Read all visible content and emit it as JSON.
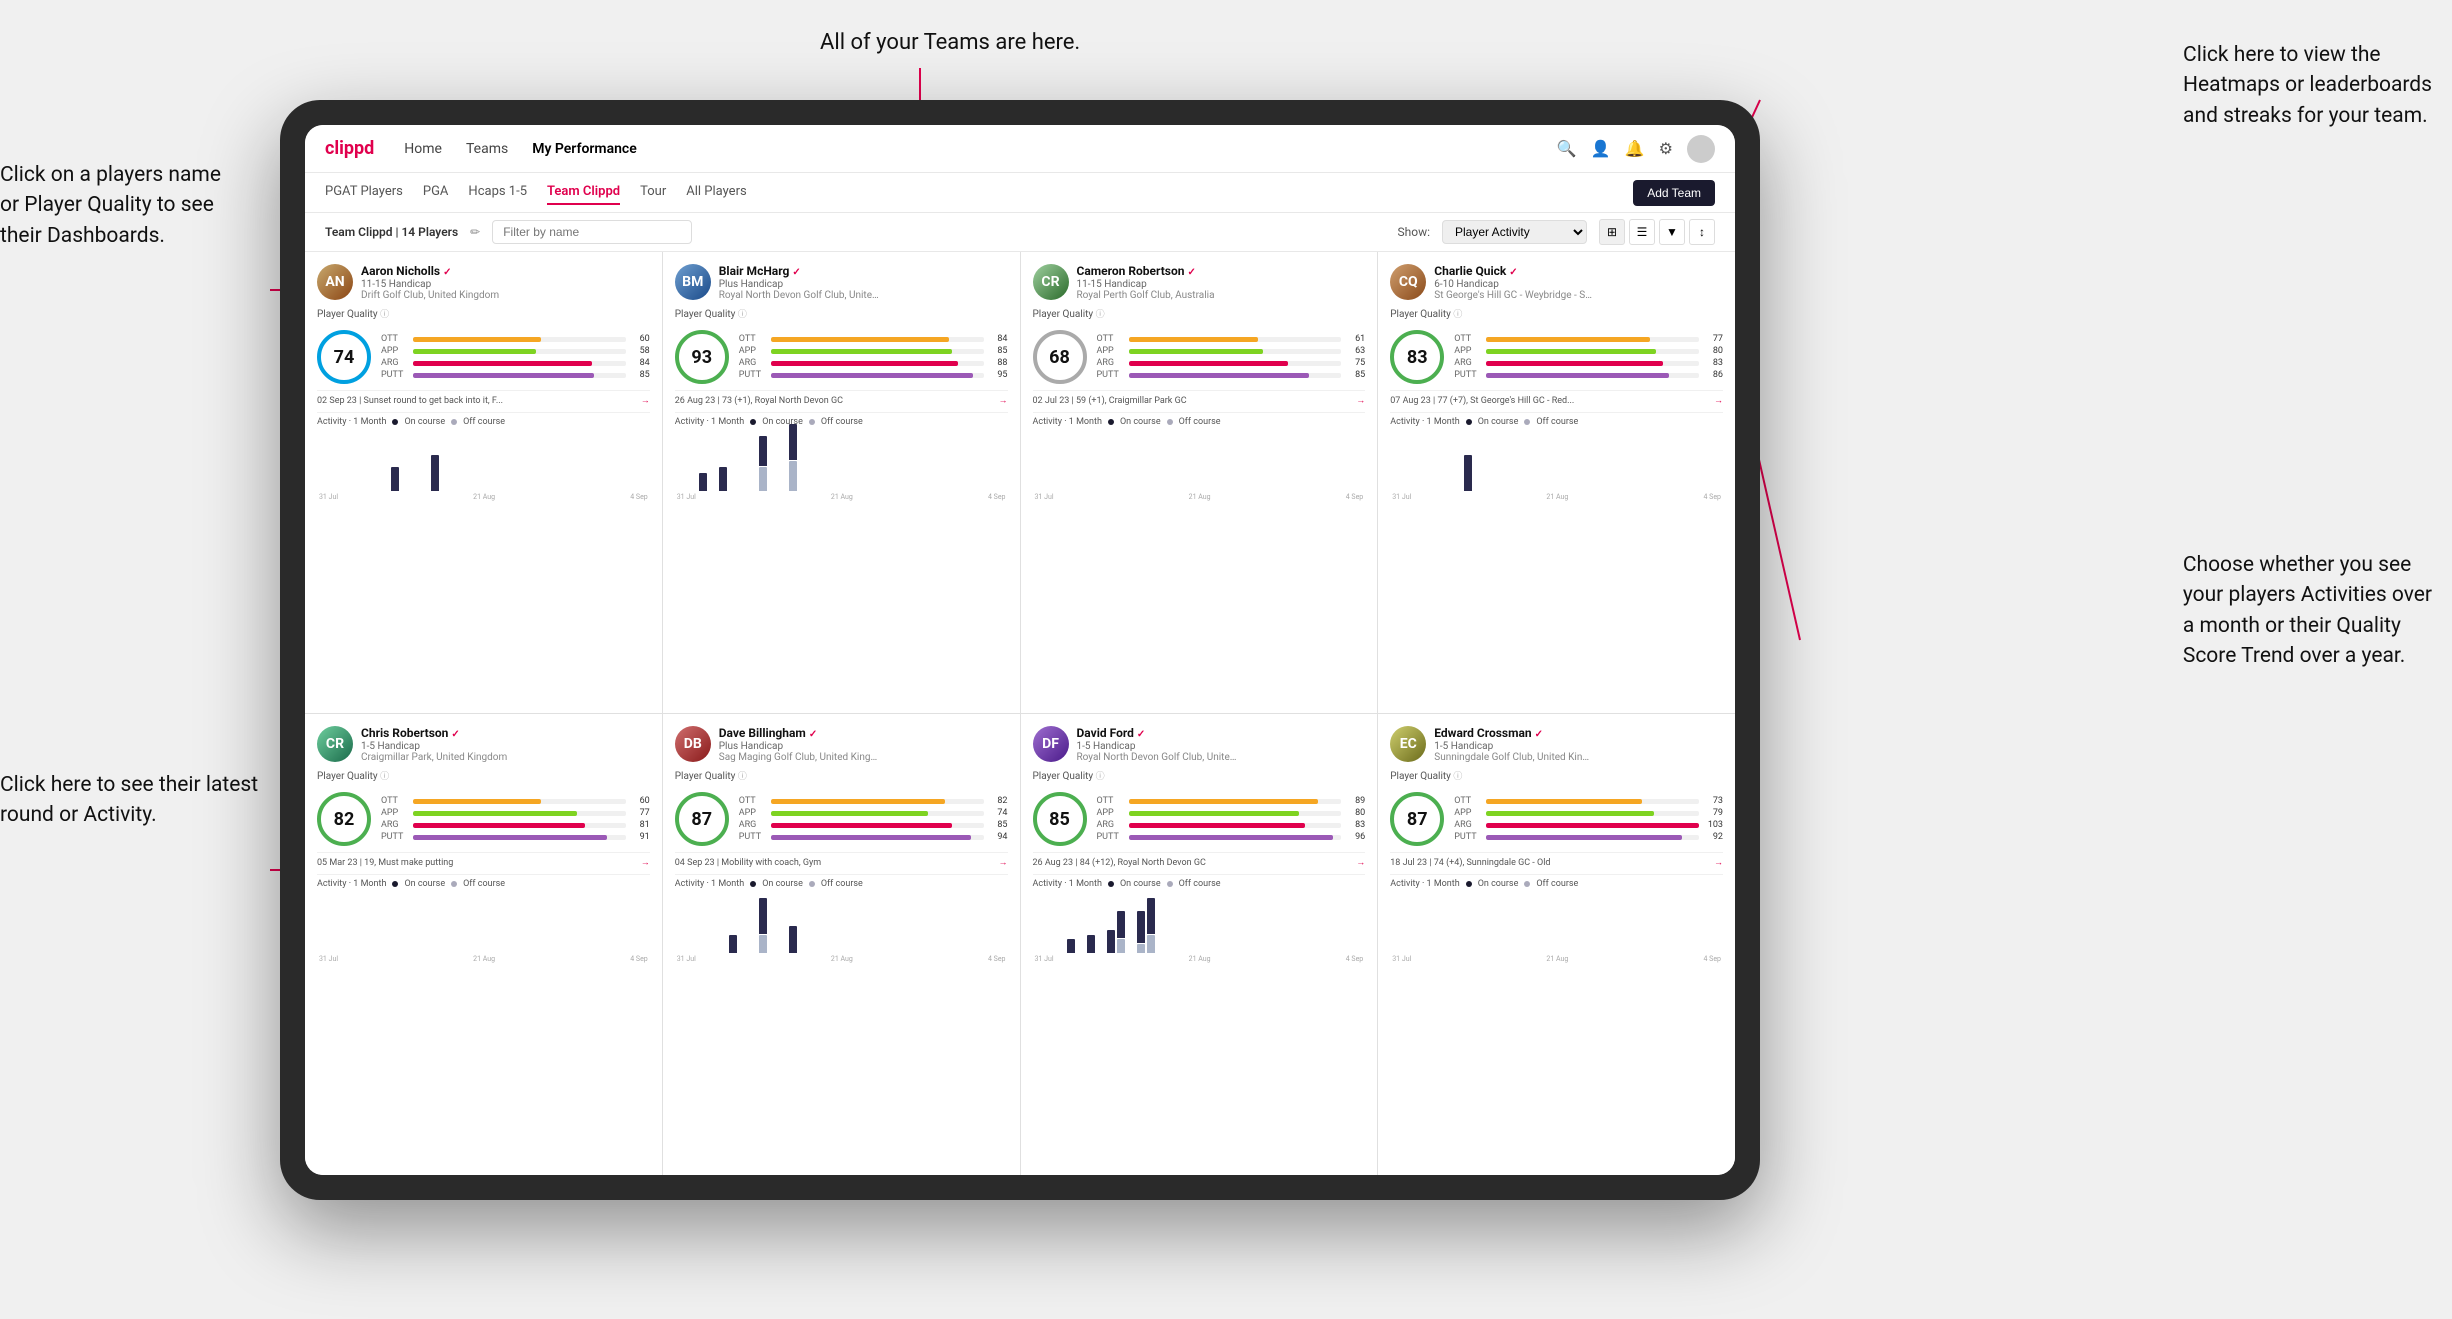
{
  "annotations": {
    "top_center": "All of your Teams are here.",
    "top_right": "Click here to view the\nHeatmaps or leaderboards\nand streaks for your team.",
    "left_top_title": "Click on a players name\nor Player Quality to see\ntheir Dashboards.",
    "left_bottom_title": "Click here to see their latest\nround or Activity.",
    "mid_right": "Choose whether you see\nyour players Activities over\na month or their Quality\nScore Trend over a year."
  },
  "navbar": {
    "logo": "clippd",
    "links": [
      "Home",
      "Teams",
      "My Performance"
    ],
    "active_link": "Teams"
  },
  "subnav": {
    "items": [
      "PGAT Players",
      "PGA",
      "Hcaps 1-5",
      "Team Clippd",
      "Tour",
      "All Players"
    ],
    "active": "Team Clippd",
    "add_team_label": "Add Team"
  },
  "filterbar": {
    "team_label": "Team Clippd | 14 Players",
    "search_placeholder": "Filter by name",
    "show_label": "Show:",
    "show_option": "Player Activity",
    "grid_icon": "⊞",
    "list_icon": "☰",
    "filter_icon": "▼",
    "sort_icon": "↕"
  },
  "players": [
    {
      "name": "Aaron Nicholls",
      "handicap": "11-15 Handicap",
      "club": "Drift Golf Club, United Kingdom",
      "quality": 74,
      "quality_color": "blue",
      "stats": {
        "ott": 60,
        "app": 58,
        "arg": 84,
        "putt": 85
      },
      "last_round": "02 Sep 23 | Sunset round to get back into it, F...",
      "avatar_class": "avatar-aaron",
      "avatar_initials": "AN",
      "activity_bars": [
        0,
        0,
        0,
        0,
        0,
        0,
        0,
        2,
        0,
        0,
        0,
        3,
        0,
        0
      ],
      "activity_bars2": [
        0,
        0,
        0,
        0,
        0,
        0,
        0,
        0,
        0,
        0,
        0,
        0,
        0,
        0
      ]
    },
    {
      "name": "Blair McHarg",
      "handicap": "Plus Handicap",
      "club": "Royal North Devon Golf Club, United Kin...",
      "quality": 93,
      "quality_color": "green",
      "stats": {
        "ott": 84,
        "app": 85,
        "arg": 88,
        "putt": 95
      },
      "last_round": "26 Aug 23 | 73 (+1), Royal North Devon GC",
      "avatar_class": "avatar-blair",
      "avatar_initials": "BM",
      "activity_bars": [
        0,
        0,
        3,
        0,
        4,
        0,
        0,
        0,
        5,
        0,
        0,
        6,
        0,
        0
      ],
      "activity_bars2": [
        0,
        0,
        0,
        0,
        0,
        0,
        0,
        0,
        4,
        0,
        0,
        5,
        0,
        0
      ]
    },
    {
      "name": "Cameron Robertson",
      "handicap": "11-15 Handicap",
      "club": "Royal Perth Golf Club, Australia",
      "quality": 68,
      "quality_color": "blue",
      "stats": {
        "ott": 61,
        "app": 63,
        "arg": 75,
        "putt": 85
      },
      "last_round": "02 Jul 23 | 59 (+1), Craigmillar Park GC",
      "avatar_class": "avatar-cameron",
      "avatar_initials": "CR",
      "activity_bars": [
        0,
        0,
        0,
        0,
        0,
        0,
        0,
        0,
        0,
        0,
        0,
        0,
        0,
        0
      ],
      "activity_bars2": [
        0,
        0,
        0,
        0,
        0,
        0,
        0,
        0,
        0,
        0,
        0,
        0,
        0,
        0
      ]
    },
    {
      "name": "Charlie Quick",
      "handicap": "6-10 Handicap",
      "club": "St George's Hill GC - Weybridge - Surrey...",
      "quality": 83,
      "quality_color": "green",
      "stats": {
        "ott": 77,
        "app": 80,
        "arg": 83,
        "putt": 86
      },
      "last_round": "07 Aug 23 | 77 (+7), St George's Hill GC - Red...",
      "avatar_class": "avatar-charlie",
      "avatar_initials": "CQ",
      "activity_bars": [
        0,
        0,
        0,
        0,
        0,
        0,
        0,
        3,
        0,
        0,
        0,
        0,
        0,
        0
      ],
      "activity_bars2": [
        0,
        0,
        0,
        0,
        0,
        0,
        0,
        0,
        0,
        0,
        0,
        0,
        0,
        0
      ]
    },
    {
      "name": "Chris Robertson",
      "handicap": "1-5 Handicap",
      "club": "Craigmillar Park, United Kingdom",
      "quality": 82,
      "quality_color": "blue",
      "stats": {
        "ott": 60,
        "app": 77,
        "arg": 81,
        "putt": 91
      },
      "last_round": "05 Mar 23 | 19, Must make putting",
      "avatar_class": "avatar-chris",
      "avatar_initials": "CR",
      "activity_bars": [
        0,
        0,
        0,
        0,
        0,
        0,
        0,
        0,
        0,
        0,
        0,
        0,
        0,
        0
      ],
      "activity_bars2": [
        0,
        0,
        0,
        0,
        0,
        0,
        0,
        0,
        0,
        0,
        0,
        0,
        0,
        0
      ]
    },
    {
      "name": "Dave Billingham",
      "handicap": "Plus Handicap",
      "club": "Sag Maging Golf Club, United Kingdom",
      "quality": 87,
      "quality_color": "green",
      "stats": {
        "ott": 82,
        "app": 74,
        "arg": 85,
        "putt": 94
      },
      "last_round": "04 Sep 23 | Mobility with coach, Gym",
      "avatar_class": "avatar-dave",
      "avatar_initials": "DB",
      "activity_bars": [
        0,
        0,
        0,
        0,
        0,
        2,
        0,
        0,
        4,
        0,
        0,
        3,
        0,
        0
      ],
      "activity_bars2": [
        0,
        0,
        0,
        0,
        0,
        0,
        0,
        0,
        2,
        0,
        0,
        0,
        0,
        0
      ]
    },
    {
      "name": "David Ford",
      "handicap": "1-5 Handicap",
      "club": "Royal North Devon Golf Club, United Kni...",
      "quality": 85,
      "quality_color": "green",
      "stats": {
        "ott": 89,
        "app": 80,
        "arg": 83,
        "putt": 96
      },
      "last_round": "26 Aug 23 | 84 (+12), Royal North Devon GC",
      "avatar_class": "avatar-david",
      "avatar_initials": "DF",
      "activity_bars": [
        0,
        0,
        0,
        3,
        0,
        4,
        0,
        5,
        6,
        0,
        7,
        8,
        0,
        0
      ],
      "activity_bars2": [
        0,
        0,
        0,
        0,
        0,
        0,
        0,
        0,
        3,
        0,
        2,
        4,
        0,
        0
      ]
    },
    {
      "name": "Edward Crossman",
      "handicap": "1-5 Handicap",
      "club": "Sunningdale Golf Club, United Kingdom",
      "quality": 87,
      "quality_color": "green",
      "stats": {
        "ott": 73,
        "app": 79,
        "arg": 103,
        "putt": 92
      },
      "last_round": "18 Jul 23 | 74 (+4), Sunningdale GC - Old",
      "avatar_class": "avatar-edward",
      "avatar_initials": "EC",
      "activity_bars": [
        0,
        0,
        0,
        0,
        0,
        0,
        0,
        0,
        0,
        0,
        0,
        0,
        0,
        0
      ],
      "activity_bars2": [
        0,
        0,
        0,
        0,
        0,
        0,
        0,
        0,
        0,
        0,
        0,
        0,
        0,
        0
      ]
    }
  ],
  "activity_x_labels": [
    "31 Jul",
    "21 Aug",
    "4 Sep"
  ],
  "activity_title": "Activity · 1 Month",
  "legend_on": "On course",
  "legend_off": "Off course"
}
